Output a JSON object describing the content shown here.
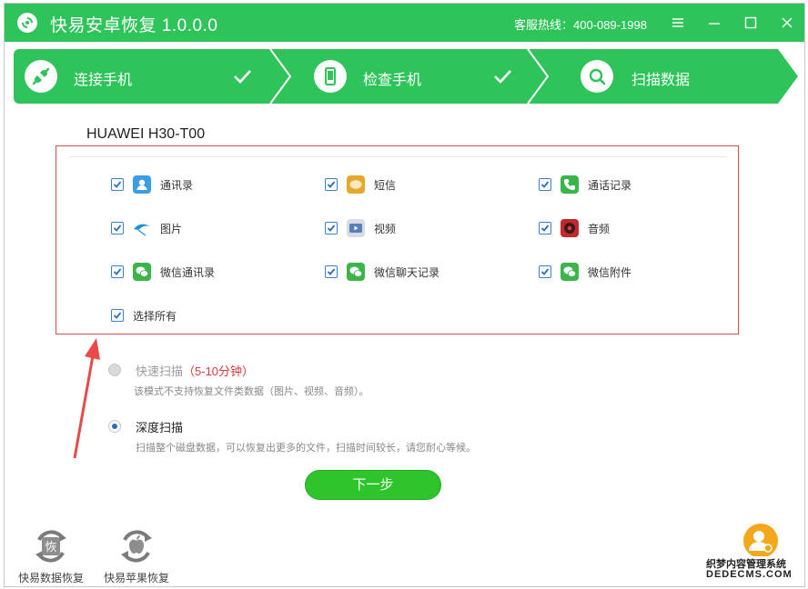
{
  "app": {
    "title": "快易安卓恢复  1.0.0.0",
    "hotline": "客服热线：400-089-1998"
  },
  "steps": [
    {
      "label": "连接手机",
      "done": true
    },
    {
      "label": "检查手机",
      "done": true
    },
    {
      "label": "扫描数据",
      "done": false
    }
  ],
  "device": {
    "name": "HUAWEI H30-T00"
  },
  "options": [
    {
      "label": "通讯录",
      "checked": true,
      "icon": "contacts-icon"
    },
    {
      "label": "短信",
      "checked": true,
      "icon": "sms-icon"
    },
    {
      "label": "通话记录",
      "checked": true,
      "icon": "call-log-icon"
    },
    {
      "label": "图片",
      "checked": true,
      "icon": "picture-icon"
    },
    {
      "label": "视频",
      "checked": true,
      "icon": "video-icon"
    },
    {
      "label": "音频",
      "checked": true,
      "icon": "audio-icon"
    },
    {
      "label": "微信通讯录",
      "checked": true,
      "icon": "wechat-icon"
    },
    {
      "label": "微信聊天记录",
      "checked": true,
      "icon": "wechat-icon"
    },
    {
      "label": "微信附件",
      "checked": true,
      "icon": "wechat-icon"
    }
  ],
  "select_all": {
    "label": "选择所有",
    "checked": true
  },
  "scan_modes": {
    "quick": {
      "title": "快速扫描",
      "duration": "（5-10分钟）",
      "desc": "该模式不支持恢复文件类数据（图片、视频、音频）。",
      "selected": false,
      "enabled": false
    },
    "deep": {
      "title": "深度扫描",
      "desc": "扫描整个磁盘数据，可以恢复出更多的文件，扫描时间较长，请您耐心等候。",
      "selected": true,
      "enabled": true
    }
  },
  "next_button": {
    "label": "下一步"
  },
  "tools": [
    {
      "label": "快易数据恢复",
      "icon": "data-recovery-icon"
    },
    {
      "label": "快易苹果恢复",
      "icon": "apple-recovery-icon"
    }
  ],
  "watermark": {
    "line1": "织梦内容管理系统",
    "line2": "DEDECMS.COM"
  },
  "colors": {
    "brand_green": "#2ec45a",
    "highlight_red": "#e54848",
    "accent_red": "#d9393c",
    "checkbox_blue": "#2a6cc9"
  }
}
